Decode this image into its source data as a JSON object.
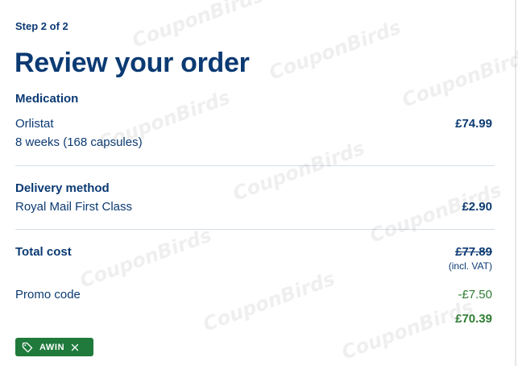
{
  "step": "Step 2 of 2",
  "title": "Review your order",
  "medication": {
    "heading": "Medication",
    "name": "Orlistat",
    "detail": "8 weeks (168 capsules)",
    "price": "£74.99"
  },
  "delivery": {
    "heading": "Delivery method",
    "method": "Royal Mail First Class",
    "price": "£2.90"
  },
  "total": {
    "label": "Total cost",
    "original_price": "£77.89",
    "vat_note": "(incl. VAT)",
    "promo_label": "Promo code",
    "discount": "-£7.50",
    "final_price": "£70.39"
  },
  "promo_chip": {
    "code": "AWIN",
    "icon": "tag-icon",
    "remove_icon": "close-icon"
  },
  "watermark": "CouponBirds",
  "colors": {
    "heading": "#0b3a73",
    "discount": "#2e7d32",
    "chip_bg": "#1f7a3b"
  }
}
